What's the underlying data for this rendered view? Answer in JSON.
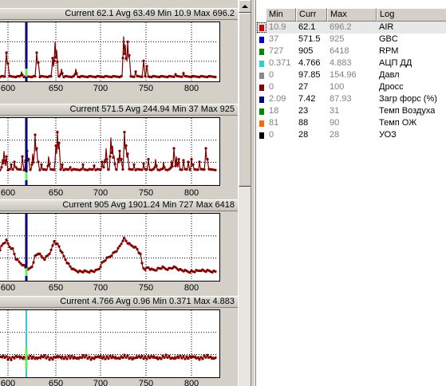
{
  "charts": [
    {
      "header": "Current 62.1 Avg 63.49 Min 10.9 Max 696.2",
      "x_ticks": [
        "600",
        "650",
        "700",
        "750",
        "800"
      ],
      "series": [
        0.05,
        0.05,
        0.05,
        0.06,
        0.05,
        0.05,
        0.06,
        0.05,
        0.05,
        0.06,
        0.05,
        0.05,
        0.05,
        0.05,
        0.06,
        0.05,
        0.05,
        0.06,
        0.05,
        0.05,
        0.05,
        0.05,
        0.05,
        0.05,
        0.05,
        0.05,
        0.06,
        0.05,
        0.05,
        0.05,
        0.05,
        0.06,
        0.05,
        0.05,
        0.05,
        0.06,
        0.05,
        0.05,
        0.05,
        0.06,
        0.05,
        0.05,
        0.05,
        0.05,
        0.06,
        0.05,
        0.05,
        0.05,
        0.05,
        0.05,
        0.05,
        0.05,
        0.06,
        0.05,
        0.05,
        0.05,
        0.05,
        0.05,
        0.05,
        0.05,
        0.05,
        0.05,
        0.05,
        0.05,
        0.05,
        0.05,
        0.06,
        0.05,
        0.05,
        0.05,
        0.05,
        0.05,
        0.06,
        0.05,
        0.05,
        0.05,
        0.05,
        0.05,
        0.05,
        0.05,
        0.05,
        0.05,
        0.05,
        0.06,
        0.05,
        0.05,
        0.05,
        0.05,
        0.05,
        0.05,
        0.05,
        0.05,
        0.05,
        0.05,
        0.05,
        0.06,
        0.05,
        0.05,
        0.05,
        0.06,
        0.05,
        0.05,
        0.05,
        0.05,
        0.05,
        0.05,
        0.05,
        0.05,
        0.05,
        0.05,
        0.05,
        0.05,
        0.05,
        0.06,
        0.05,
        0.05,
        0.05,
        0.05,
        0.05,
        0.05,
        0.05,
        0.05,
        0.05,
        0.06,
        0.05,
        0.05,
        0.05,
        0.05,
        0.05,
        0.05,
        0.05,
        0.05,
        0.05,
        0.05,
        0.05,
        0.05,
        0.05,
        0.05,
        0.05,
        0.05,
        0.05,
        0.05,
        0.05,
        0.05,
        0.05,
        0.05,
        0.05,
        0.05,
        0.05,
        0.05,
        0.05,
        0.05,
        0.05,
        0.05,
        0.05,
        0.05,
        0.05,
        0.05,
        0.05,
        0.05,
        0.05,
        0.05,
        0.05,
        0.05,
        0.05,
        0.05,
        0.05,
        0.05,
        0.05,
        0.05,
        0.05,
        0.05,
        0.05,
        0.05,
        0.05,
        0.05,
        0.05,
        0.05,
        0.05,
        0.05,
        0.05,
        0.05,
        0.05,
        0.05,
        0.05,
        0.05,
        0.05,
        0.05,
        0.05,
        0.05,
        0.05,
        0.05,
        0.05,
        0.05,
        0.05,
        0.05,
        0.05,
        0.05,
        0.05,
        0.05,
        0.05,
        0.05,
        0.05,
        0.05,
        0.05,
        0.05,
        0.05,
        0.05,
        0.05,
        0.05,
        0.05,
        0.05,
        0.05,
        0.05,
        0.05,
        0.05,
        0.05,
        0.05,
        0.05,
        0.05,
        0.05,
        0.05,
        0.05,
        0.05,
        0.05,
        0.05,
        0.05,
        0.05,
        0.05,
        0.05,
        0.05,
        0.05,
        0.05,
        0.05,
        0.05,
        0.05,
        0.05,
        0.05,
        0.05,
        0.05,
        0.05,
        0.05,
        0.05,
        0.05,
        0.05,
        0.05,
        0.05,
        0.05,
        0.05,
        0.05,
        0.05,
        0.05,
        0.05,
        0.05,
        0.05,
        0.05,
        0.05,
        0.05,
        0.05,
        0.05,
        0.05,
        0.05,
        0.05,
        0.05,
        0.05
      ],
      "spikes": [
        [
          8,
          0.5
        ],
        [
          10,
          0.3
        ],
        [
          27,
          0.15
        ],
        [
          46,
          0.5
        ],
        [
          48,
          0.32
        ],
        [
          66,
          0.4
        ],
        [
          69,
          0.7
        ],
        [
          71,
          0.55
        ],
        [
          77,
          0.2
        ],
        [
          95,
          0.2
        ],
        [
          155,
          0.8
        ],
        [
          157,
          0.65
        ],
        [
          160,
          0.7
        ],
        [
          162,
          0.45
        ],
        [
          170,
          0.15
        ],
        [
          180,
          0.35
        ],
        [
          184,
          0.25
        ],
        [
          220,
          0.1
        ],
        [
          230,
          0.12
        ]
      ]
    },
    {
      "header": "Current 571.5 Avg 244.94 Min 37 Max 925",
      "x_ticks": [
        "600",
        "650",
        "700",
        "750",
        "800"
      ],
      "spikes": [
        [
          3,
          0.3
        ],
        [
          5,
          0.45
        ],
        [
          8,
          0.35
        ],
        [
          14,
          0.2
        ],
        [
          18,
          0.25
        ],
        [
          20,
          0.15
        ],
        [
          28,
          0.35
        ],
        [
          33,
          0.55
        ],
        [
          34,
          0.45
        ],
        [
          36,
          0.3
        ],
        [
          41,
          0.4
        ],
        [
          44,
          0.75
        ],
        [
          46,
          0.5
        ],
        [
          48,
          0.25
        ],
        [
          52,
          0.2
        ],
        [
          61,
          0.35
        ],
        [
          70,
          0.55
        ],
        [
          72,
          0.8
        ],
        [
          74,
          0.6
        ],
        [
          78,
          0.2
        ],
        [
          88,
          0.15
        ],
        [
          104,
          0.2
        ],
        [
          118,
          0.18
        ],
        [
          128,
          0.25
        ],
        [
          131,
          0.3
        ],
        [
          133,
          0.5
        ],
        [
          139,
          0.7
        ],
        [
          141,
          0.55
        ],
        [
          143,
          0.35
        ],
        [
          148,
          0.3
        ],
        [
          150,
          0.45
        ],
        [
          152,
          0.3
        ],
        [
          156,
          0.8
        ],
        [
          158,
          0.55
        ],
        [
          160,
          0.4
        ],
        [
          168,
          0.2
        ],
        [
          180,
          0.22
        ],
        [
          186,
          0.3
        ],
        [
          195,
          0.3
        ],
        [
          205,
          0.25
        ],
        [
          215,
          0.28
        ],
        [
          218,
          0.5
        ],
        [
          221,
          0.35
        ],
        [
          224,
          0.3
        ],
        [
          230,
          0.28
        ],
        [
          236,
          0.25
        ],
        [
          240,
          0.3
        ],
        [
          242,
          0.2
        ],
        [
          250,
          0.25
        ],
        [
          258,
          0.5
        ],
        [
          260,
          0.3
        ]
      ],
      "baseline": 0.1
    },
    {
      "header": "Current 905 Avg 1901.24 Min 727 Max 6418",
      "x_ticks": [
        "600",
        "650",
        "700",
        "750",
        "800"
      ],
      "shape": [
        [
          0,
          0.45
        ],
        [
          4,
          0.55
        ],
        [
          8,
          0.6
        ],
        [
          12,
          0.5
        ],
        [
          16,
          0.45
        ],
        [
          20,
          0.28
        ],
        [
          24,
          0.22
        ],
        [
          28,
          0.18
        ],
        [
          32,
          0.12
        ],
        [
          36,
          0.08
        ],
        [
          40,
          0.14
        ],
        [
          44,
          0.32
        ],
        [
          48,
          0.38
        ],
        [
          52,
          0.32
        ],
        [
          56,
          0.28
        ],
        [
          60,
          0.34
        ],
        [
          64,
          0.42
        ],
        [
          68,
          0.6
        ],
        [
          71,
          0.55
        ],
        [
          74,
          0.5
        ],
        [
          77,
          0.4
        ],
        [
          80,
          0.32
        ],
        [
          84,
          0.22
        ],
        [
          88,
          0.14
        ],
        [
          92,
          0.08
        ],
        [
          100,
          0.05
        ],
        [
          110,
          0.05
        ],
        [
          120,
          0.06
        ],
        [
          124,
          0.1
        ],
        [
          128,
          0.2
        ],
        [
          132,
          0.26
        ],
        [
          136,
          0.3
        ],
        [
          140,
          0.35
        ],
        [
          144,
          0.4
        ],
        [
          148,
          0.45
        ],
        [
          152,
          0.55
        ],
        [
          155,
          0.65
        ],
        [
          158,
          0.6
        ],
        [
          161,
          0.55
        ],
        [
          164,
          0.52
        ],
        [
          168,
          0.5
        ],
        [
          172,
          0.45
        ],
        [
          176,
          0.35
        ],
        [
          179,
          0.12
        ],
        [
          182,
          0.1
        ],
        [
          186,
          0.12
        ],
        [
          190,
          0.08
        ],
        [
          194,
          0.08
        ],
        [
          198,
          0.1
        ],
        [
          204,
          0.12
        ],
        [
          208,
          0.1
        ],
        [
          212,
          0.1
        ],
        [
          216,
          0.12
        ],
        [
          220,
          0.12
        ],
        [
          226,
          0.08
        ],
        [
          232,
          0.06
        ],
        [
          236,
          0.05
        ],
        [
          242,
          0.05
        ],
        [
          248,
          0.06
        ],
        [
          252,
          0.08
        ],
        [
          256,
          0.06
        ],
        [
          262,
          0.06
        ],
        [
          268,
          0.05
        ]
      ]
    },
    {
      "header": "Current 4.766 Avg 0.96 Min 0.371 Max 4.883",
      "x_ticks": [
        "600",
        "650",
        "700",
        "750",
        "800"
      ],
      "noise": 0.3
    }
  ],
  "cursor_label": "",
  "legend": {
    "columns": [
      "Min",
      "Curr",
      "Max",
      "Log"
    ],
    "rows": [
      {
        "min": "10.9",
        "curr": "62.1",
        "max": "696.2",
        "log": "AIR",
        "color": "#cc0000",
        "selected": true
      },
      {
        "min": "37",
        "curr": "571.5",
        "max": "925",
        "log": "GBC",
        "color": "#0000cc"
      },
      {
        "min": "727",
        "curr": "905",
        "max": "6418",
        "log": "RPM",
        "color": "#008800"
      },
      {
        "min": "0.371",
        "curr": "4.766",
        "max": "4.883",
        "log": "АЦП ДД",
        "color": "#33cccc"
      },
      {
        "min": "0",
        "curr": "97.85",
        "max": "154.96",
        "log": "Давл",
        "color": "#888888"
      },
      {
        "min": "0",
        "curr": "27",
        "max": "100",
        "log": "Дросс",
        "color": "#880000"
      },
      {
        "min": "2.09",
        "curr": "7.42",
        "max": "87.93",
        "log": "Загр форс (%)",
        "color": "#000088"
      },
      {
        "min": "18",
        "curr": "23",
        "max": "31",
        "log": "Темп Воздуха",
        "color": "#008800"
      },
      {
        "min": "81",
        "curr": "88",
        "max": "90",
        "log": "Темп ОЖ",
        "color": "#ff6600"
      },
      {
        "min": "0",
        "curr": "28",
        "max": "28",
        "log": "УОЗ",
        "color": "#000000"
      }
    ]
  }
}
